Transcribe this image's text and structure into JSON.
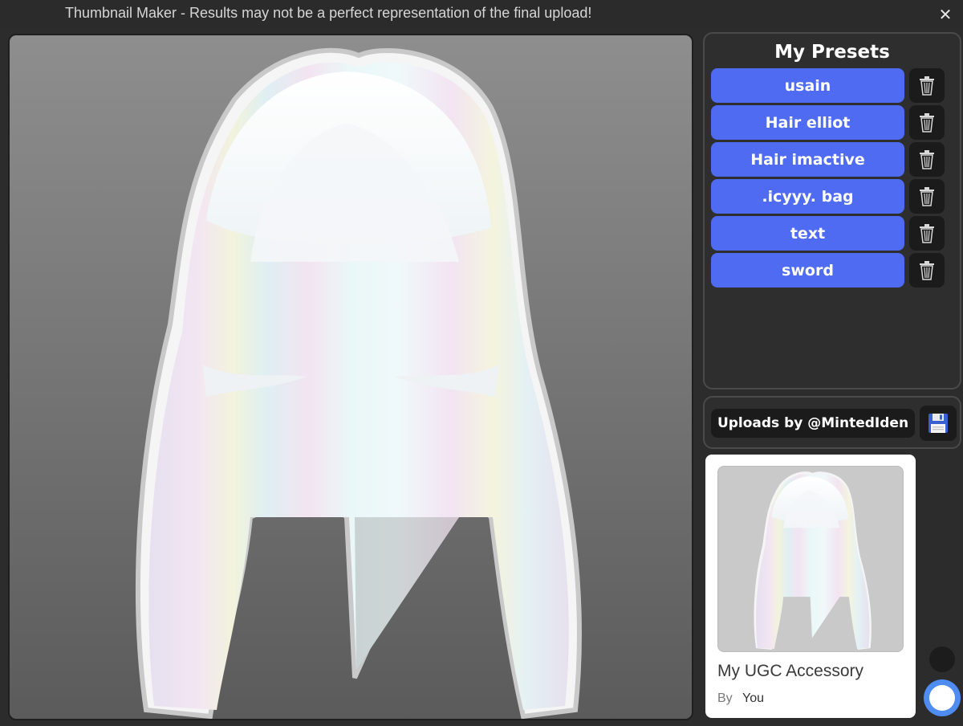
{
  "window": {
    "title": "Thumbnail Maker - Results may not be a perfect representation of the final upload!",
    "close_glyph": "✕"
  },
  "presets": {
    "title": "My Presets",
    "items": [
      {
        "label": "usain"
      },
      {
        "label": "Hair elliot"
      },
      {
        "label": "Hair imactive"
      },
      {
        "label": ".icyyy. bag"
      },
      {
        "label": "text"
      },
      {
        "label": "sword"
      }
    ],
    "delete_icon": "trash-icon"
  },
  "uploads": {
    "label": "Uploads by @MintedIden",
    "save_icon": "floppy-disk-icon"
  },
  "card": {
    "name": "My UGC Accessory",
    "by_label": "By",
    "creator": "You"
  },
  "colors": {
    "accent": "#4f6bf2",
    "toggle": "#4f8cf2"
  }
}
